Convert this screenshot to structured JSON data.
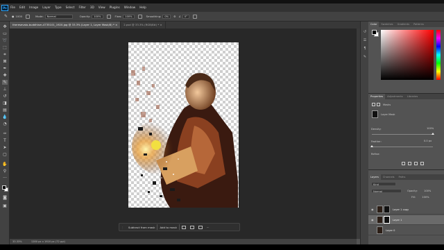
{
  "menu": {
    "logo": "Ps",
    "items": [
      "File",
      "Edit",
      "Image",
      "Layer",
      "Type",
      "Select",
      "Filter",
      "3D",
      "View",
      "Plugins",
      "Window",
      "Help"
    ]
  },
  "options": {
    "brush_size": "1000",
    "mode_label": "Mode:",
    "mode_value": "Normal",
    "opacity_label": "Opacity:",
    "opacity_value": "100%",
    "flow_label": "Flow:",
    "flow_value": "100%",
    "smoothing_label": "Smoothing:",
    "smoothing_value": "0%",
    "angle_value": "0°"
  },
  "tabs": [
    {
      "label": "theresevaio-buddhism-4735101_1920.jpg @ 33.3% (Layer 1, Layer Mask/8) * ×"
    },
    {
      "label": "2.psd @ 33.3% (RGB/8#) * ×"
    }
  ],
  "contextual_taskbar": {
    "subtract": "Subtract from mask",
    "add": "Add to mask",
    "more": "···"
  },
  "status": {
    "zoom": "33.33%",
    "doc_info": "1280 px x 1920 px (72 ppi)"
  },
  "color_panel": {
    "tabs": [
      "Color",
      "Swatches",
      "Gradients",
      "Patterns"
    ],
    "foreground": "#000000",
    "background": "#ffffff",
    "hue_color": "#ff0000"
  },
  "properties_panel": {
    "tabs": [
      "Properties",
      "Adjustments",
      "Libraries"
    ],
    "masks_label": "Masks",
    "layer_mask_label": "Layer Mask",
    "density_label": "Density:",
    "density_value": "100%",
    "density_level": 1.0,
    "feather_label": "Feather:",
    "feather_value": "0.0 px",
    "feather_level": 0.0,
    "refine_label": "Refine:"
  },
  "layers_panel": {
    "tabs": [
      "Layers",
      "Channels",
      "Paths"
    ],
    "filter_label": "Kind",
    "blend_mode": "Normal",
    "opacity_label": "Opacity:",
    "opacity_value": "100%",
    "fill_label": "Fill:",
    "fill_value": "100%",
    "layers": [
      {
        "name": "Layer 1 copy"
      },
      {
        "name": "Layer 1"
      },
      {
        "name": "Layer 0"
      }
    ]
  }
}
